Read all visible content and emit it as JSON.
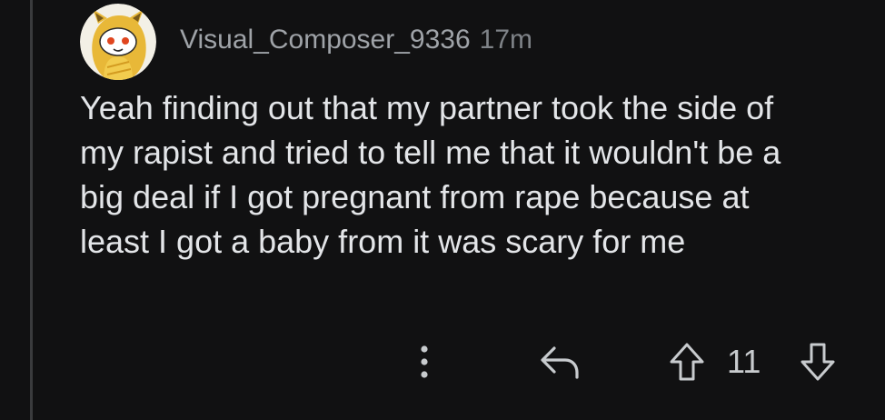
{
  "comment": {
    "author": "Visual_Composer_9336",
    "timestamp": "17m",
    "avatar_icon": "snoo-avatar-icon",
    "body": "Yeah finding out that my partner took the side of my rapist and tried to tell me that it wouldn't be a big deal if I got pregnant from rape because at least I got a baby from it was scary for me",
    "actions": {
      "more_icon": "more-vertical-icon",
      "reply_icon": "reply-arrow-icon",
      "upvote_icon": "upvote-arrow-icon",
      "vote_count": "11",
      "downvote_icon": "downvote-arrow-icon"
    }
  },
  "colors": {
    "background": "#111112",
    "text": "#e3e5e8",
    "meta": "#9fa3a8",
    "thread_line": "#3a3b3d"
  }
}
